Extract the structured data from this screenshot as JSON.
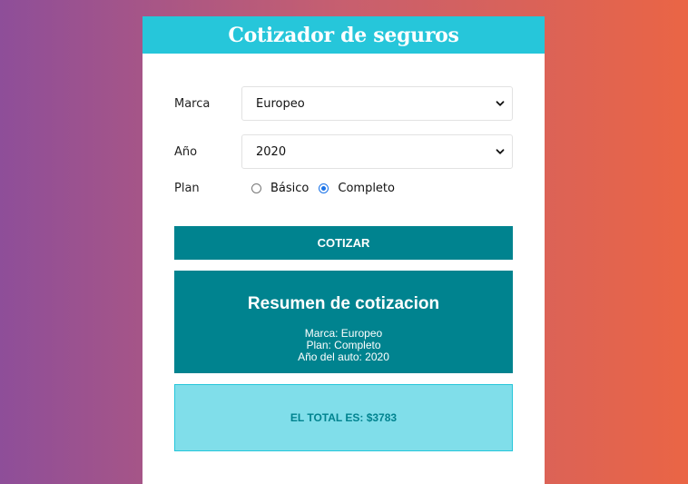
{
  "header": {
    "title": "Cotizador de seguros"
  },
  "form": {
    "marca": {
      "label": "Marca",
      "value": "Europeo"
    },
    "anio": {
      "label": "Año",
      "value": "2020"
    },
    "plan": {
      "label": "Plan",
      "options": [
        {
          "label": "Básico",
          "checked": false
        },
        {
          "label": "Completo",
          "checked": true
        }
      ]
    },
    "submit_label": "COTIZAR"
  },
  "summary": {
    "title": "Resumen de cotizacion",
    "marca_line": "Marca: Europeo",
    "plan_line": "Plan: Completo",
    "anio_line": "Año del auto: 2020"
  },
  "total": {
    "text": "EL TOTAL ES: $3783"
  },
  "colors": {
    "header": "#26c6da",
    "primary": "#00838f",
    "total_bg": "#80deea",
    "radio_accent": "#1a73e8",
    "gradient_left": "#8e4e99",
    "gradient_right": "#ea6545"
  }
}
